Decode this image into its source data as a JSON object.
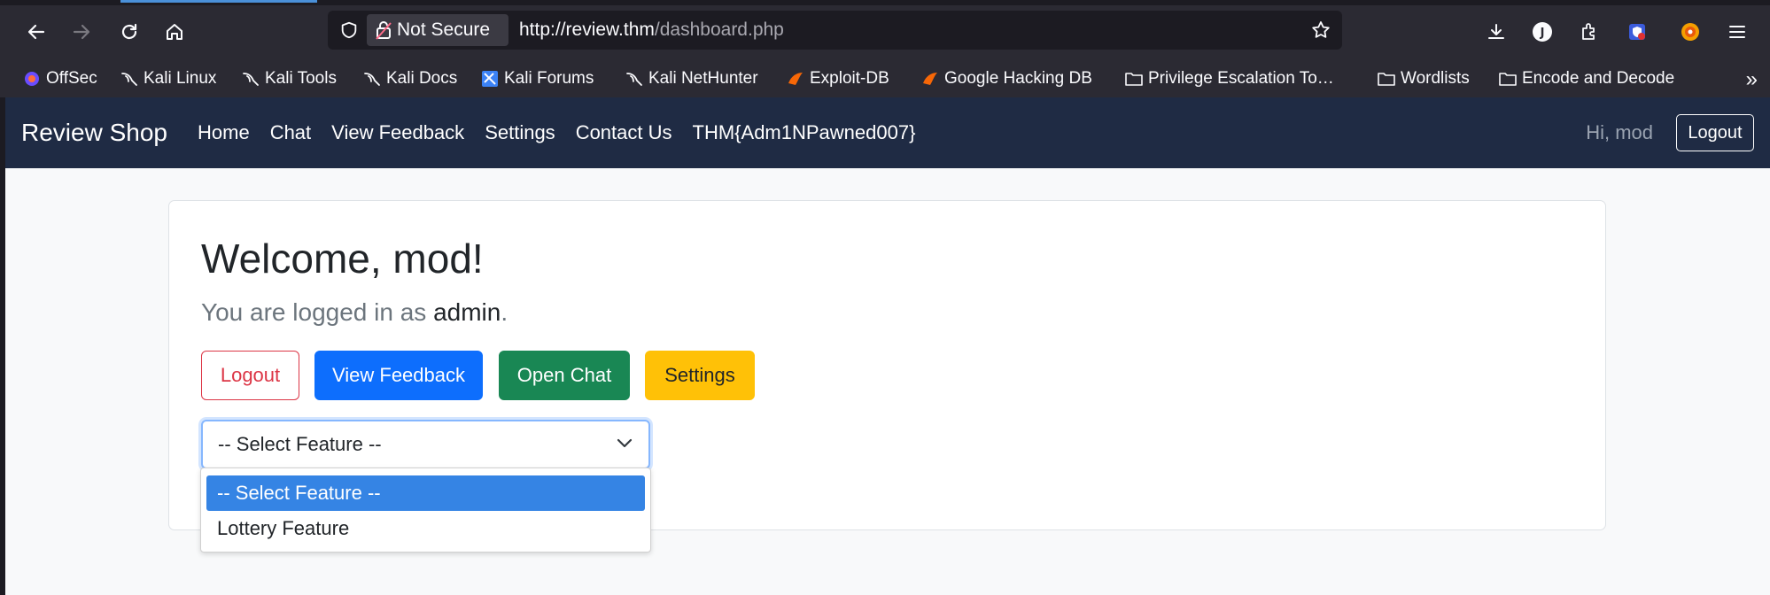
{
  "browser": {
    "url_security_label": "Not Secure",
    "url_host": "http://review.thm",
    "url_path": "/dashboard.php",
    "bookmarks": [
      {
        "label": "OffSec",
        "icon": "offsec-icon"
      },
      {
        "label": "Kali Linux",
        "icon": "kali-icon"
      },
      {
        "label": "Kali Tools",
        "icon": "kali-icon"
      },
      {
        "label": "Kali Docs",
        "icon": "kali-icon"
      },
      {
        "label": "Kali Forums",
        "icon": "kali-forums-icon"
      },
      {
        "label": "Kali NetHunter",
        "icon": "kali-icon"
      },
      {
        "label": "Exploit-DB",
        "icon": "exploitdb-icon"
      },
      {
        "label": "Google Hacking DB",
        "icon": "exploitdb-icon"
      },
      {
        "label": "Privilege Escalation To…",
        "icon": "folder-icon"
      },
      {
        "label": "Wordlists",
        "icon": "folder-icon"
      },
      {
        "label": "Encode and Decode",
        "icon": "folder-icon"
      }
    ]
  },
  "site": {
    "brand": "Review Shop",
    "nav": [
      "Home",
      "Chat",
      "View Feedback",
      "Settings",
      "Contact Us",
      "THM{Adm1NPawned007}"
    ],
    "greeting": "Hi, mod",
    "logout": "Logout"
  },
  "main": {
    "heading": "Welcome, mod!",
    "lead_prefix": "You are logged in as ",
    "lead_user": "admin",
    "lead_suffix": ".",
    "buttons": {
      "logout": "Logout",
      "view_feedback": "View Feedback",
      "open_chat": "Open Chat",
      "settings": "Settings"
    },
    "feature_select": {
      "selected": "-- Select Feature --",
      "options": [
        "-- Select Feature --",
        "Lottery Feature"
      ]
    }
  },
  "colors": {
    "navbar_bg": "#1f2b44",
    "danger": "#dc3545",
    "primary": "#0d6efd",
    "success": "#198754",
    "warning": "#ffc107",
    "option_highlight": "#3584e4"
  }
}
